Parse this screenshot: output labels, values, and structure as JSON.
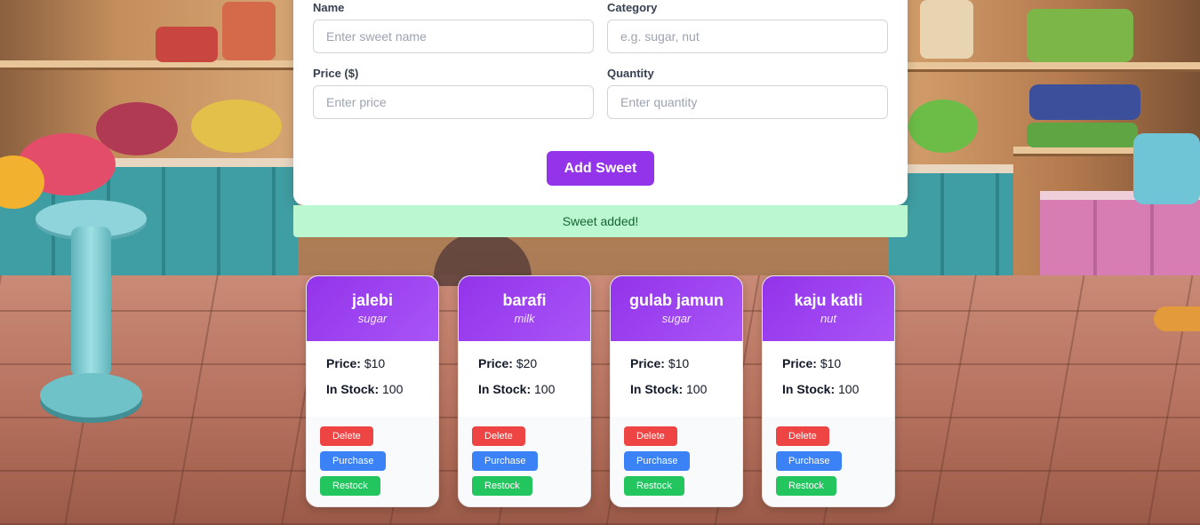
{
  "form": {
    "name": {
      "label": "Name",
      "placeholder": "Enter sweet name"
    },
    "category": {
      "label": "Category",
      "placeholder": "e.g. sugar, nut"
    },
    "price": {
      "label": "Price ($)",
      "placeholder": "Enter price"
    },
    "quantity": {
      "label": "Quantity",
      "placeholder": "Enter quantity"
    },
    "submit_label": "Add Sweet"
  },
  "toast": {
    "message": "Sweet added!"
  },
  "labels": {
    "price": "Price:",
    "stock": "In Stock:"
  },
  "actions": {
    "delete": "Delete",
    "purchase": "Purchase",
    "restock": "Restock"
  },
  "sweets": [
    {
      "name": "jalebi",
      "category": "sugar",
      "price": "$10",
      "stock": "100"
    },
    {
      "name": "barafi",
      "category": "milk",
      "price": "$20",
      "stock": "100"
    },
    {
      "name": "gulab jamun",
      "category": "sugar",
      "price": "$10",
      "stock": "100"
    },
    {
      "name": "kaju katli",
      "category": "nut",
      "price": "$10",
      "stock": "100"
    }
  ],
  "colors": {
    "accent": "#9333ea",
    "success_bg": "#bbf7d0",
    "delete": "#ef4444",
    "purchase": "#3b82f6",
    "restock": "#22c55e"
  }
}
